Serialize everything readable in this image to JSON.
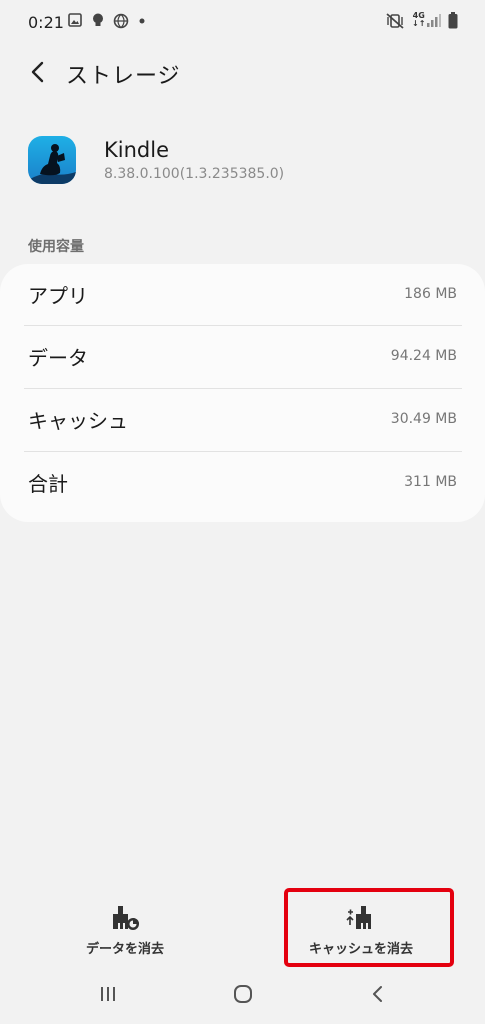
{
  "status_bar": {
    "time": "0:21",
    "icons": [
      "image-icon",
      "bulb-icon",
      "vpn-globe-icon",
      "dot-icon",
      "vibrate-mute-icon",
      "network-4g-icon",
      "signal-icon",
      "battery-icon"
    ],
    "network": "4G"
  },
  "app_bar": {
    "back_icon": "chevron-left-icon",
    "title": "ストレージ"
  },
  "app_info": {
    "name": "Kindle",
    "version": "8.38.0.100(1.3.235385.0)",
    "icon": "kindle-reader-icon"
  },
  "storage": {
    "section_header": "使用容量",
    "rows": [
      {
        "label": "アプリ",
        "value": "186 MB"
      },
      {
        "label": "データ",
        "value": "94.24 MB"
      },
      {
        "label": "キャッシュ",
        "value": "30.49 MB"
      },
      {
        "label": "合計",
        "value": "311 MB"
      }
    ]
  },
  "actions": {
    "clear_data": "データを消去",
    "clear_cache": "キャッシュを消去",
    "highlight_color": "#e4000f"
  },
  "nav_bar": {
    "icons": [
      "recent-apps-icon",
      "home-icon",
      "back-icon"
    ]
  }
}
